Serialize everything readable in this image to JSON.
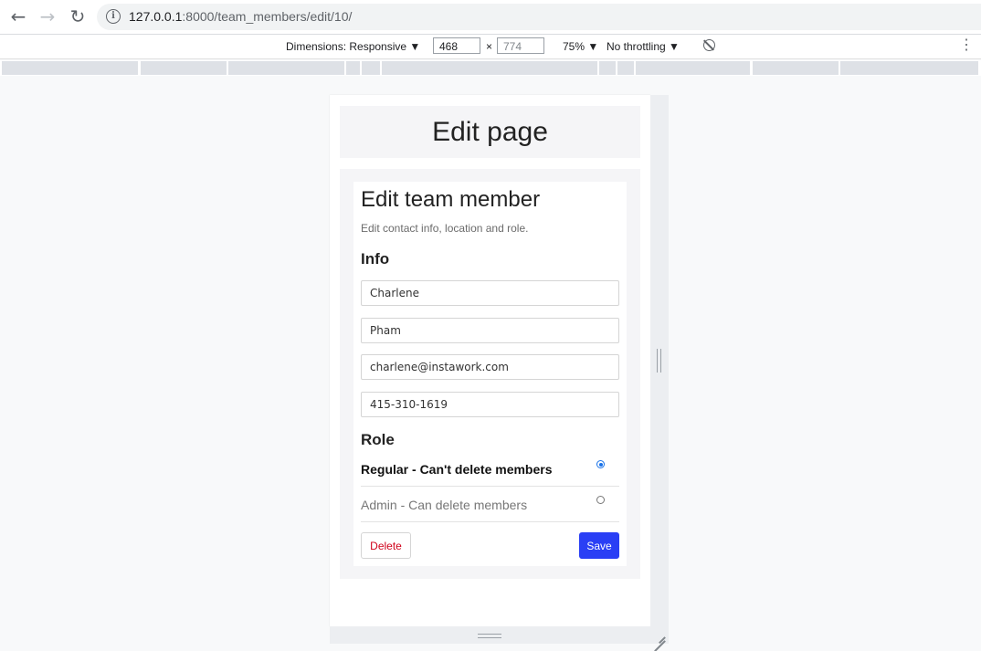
{
  "browser": {
    "url_host": "127.0.0.1",
    "url_path": ":8000/team_members/edit/10/",
    "back_icon": "←",
    "forward_icon": "→",
    "reload_icon": "↻",
    "info_icon": "i"
  },
  "devtools": {
    "dimensions_label": "Dimensions: Responsive ▼",
    "width": "468",
    "times": "×",
    "height": "774",
    "zoom": "75% ▼",
    "throttling": "No throttling ▼",
    "menu_icon": "⋮"
  },
  "page": {
    "header_title": "Edit page",
    "card_title": "Edit team member",
    "card_subtitle": "Edit contact info, location and role.",
    "info_title": "Info",
    "fields": {
      "first_name": "Charlene",
      "last_name": "Pham",
      "email": "charlene@instawork.com",
      "phone": "415-310-1619"
    },
    "role_title": "Role",
    "roles": [
      {
        "label": "Regular - Can't delete members",
        "selected": true
      },
      {
        "label": "Admin - Can delete members",
        "selected": false
      }
    ],
    "delete_label": "Delete",
    "save_label": "Save",
    "colors": {
      "save_bg": "#2a3ff5",
      "delete_text": "#d0021b"
    }
  }
}
